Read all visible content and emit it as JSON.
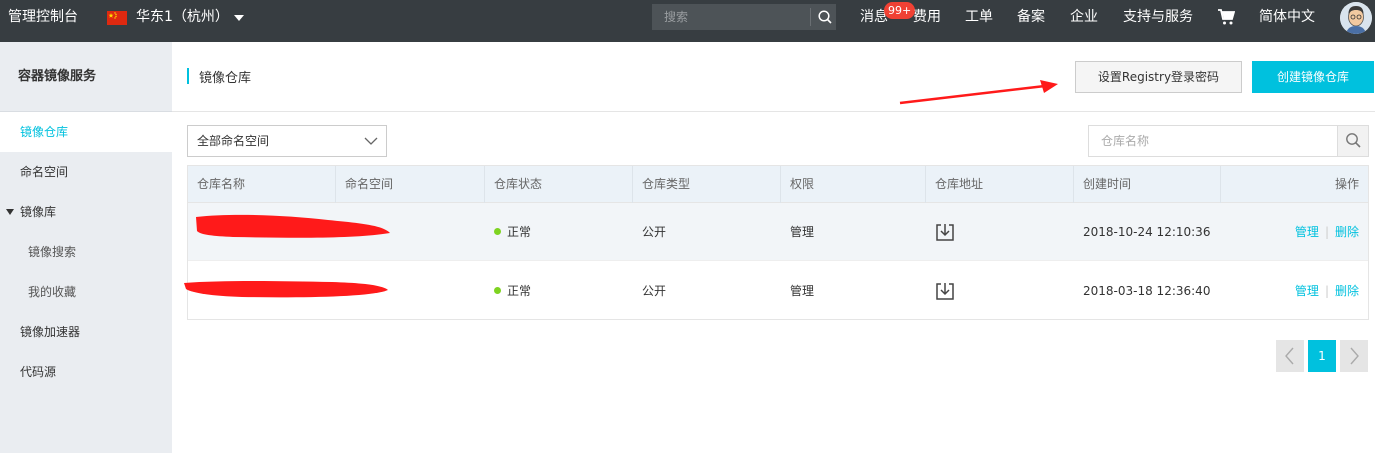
{
  "topbar": {
    "console": "管理控制台",
    "region": "华东1（杭州）",
    "search_placeholder": "搜索",
    "messages": "消息",
    "badge": "99+",
    "links": [
      "费用",
      "工单",
      "备案",
      "企业",
      "支持与服务"
    ],
    "language": "简体中文"
  },
  "sidebar": {
    "title": "容器镜像服务",
    "items": [
      {
        "label": "镜像仓库",
        "active": true
      },
      {
        "label": "命名空间"
      },
      {
        "label": "镜像库"
      },
      {
        "label": "镜像搜索"
      },
      {
        "label": "我的收藏"
      },
      {
        "label": "镜像加速器"
      },
      {
        "label": "代码源"
      }
    ]
  },
  "page": {
    "title": "镜像仓库",
    "btn_registry": "设置Registry登录密码",
    "btn_create": "创建镜像仓库",
    "namespace_select": "全部命名空间",
    "search_placeholder": "仓库名称"
  },
  "table": {
    "headers": [
      "仓库名称",
      "命名空间",
      "仓库状态",
      "仓库类型",
      "权限",
      "仓库地址",
      "创建时间",
      "操作"
    ],
    "rows": [
      {
        "status": "正常",
        "type": "公开",
        "permission": "管理",
        "created": "2018-10-24 12:10:36",
        "action_manage": "管理",
        "action_delete": "删除"
      },
      {
        "status": "正常",
        "type": "公开",
        "permission": "管理",
        "created": "2018-03-18 12:36:40",
        "action_manage": "管理",
        "action_delete": "删除"
      }
    ]
  },
  "pagination": {
    "current": "1"
  },
  "colors": {
    "accent": "#00c1de",
    "topbar": "#373d41",
    "sidebar": "#eaedf1",
    "status_ok": "#7ed321",
    "redaction": "#ff1a1a"
  }
}
